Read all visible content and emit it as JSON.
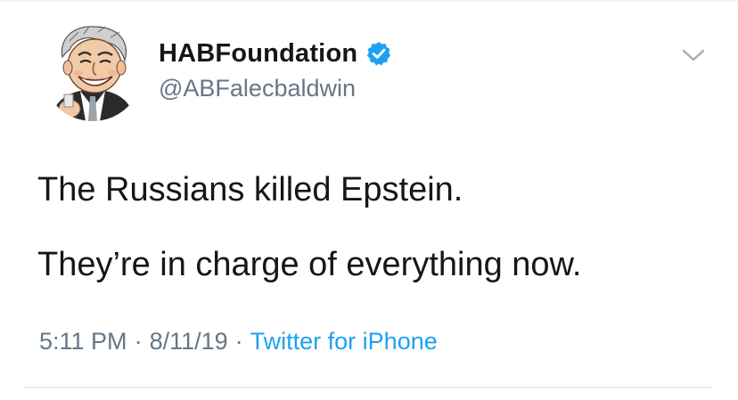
{
  "tweet": {
    "author": {
      "display_name": "HABFoundation",
      "handle": "@ABFalecbaldwin",
      "verified": true,
      "avatar_icon": "caricature-avatar"
    },
    "text_lines": [
      "The Russians killed Epstein.",
      "They’re in charge of everything now."
    ],
    "time": "5:11 PM",
    "date": "8/11/19",
    "separator": "·",
    "source": "Twitter for iPhone"
  },
  "icons": {
    "verified": "verified-badge-icon",
    "menu": "chevron-down-icon"
  },
  "colors": {
    "text_primary": "#14171a",
    "text_secondary": "#657786",
    "accent": "#1da1f2",
    "verified": "#1da1f2",
    "divider": "#e6ecf0"
  }
}
